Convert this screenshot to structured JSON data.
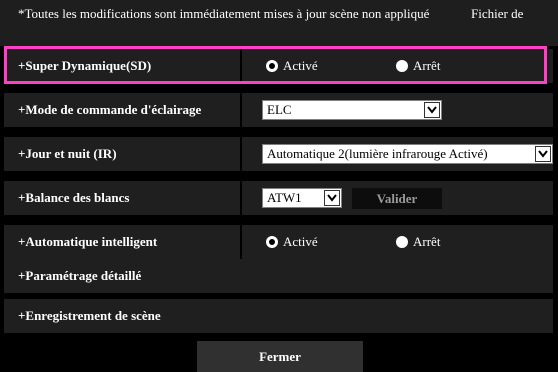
{
  "notice": {
    "message": "*Toutes les modifications sont immédiatement mises à jour scène non appliqué",
    "file_label": "Fichier de"
  },
  "rows": {
    "super_dynamic": {
      "label": "+Super Dynamique(SD)",
      "option_on": "Activé",
      "option_off": "Arrêt",
      "selected": "Activé"
    },
    "light_control": {
      "label": "+Mode de commande d'éclairage",
      "value": "ELC"
    },
    "day_night": {
      "label": "+Jour et nuit (IR)",
      "value": "Automatique 2(lumière infrarouge Activé)"
    },
    "white_balance": {
      "label": "+Balance des blancs",
      "value": "ATW1",
      "apply_label": "Valider"
    },
    "intelligent_auto": {
      "label": "+Automatique intelligent",
      "option_on": "Activé",
      "option_off": "Arrêt",
      "selected": "Activé"
    },
    "detailed": {
      "label": "+Paramétrage détaillé"
    },
    "scene_save": {
      "label": "+Enregistrement de scène"
    }
  },
  "close_label": "Fermer",
  "colors": {
    "highlight": "#ff3fc6",
    "row_bg": "#1f1f1f",
    "button_bg": "#303030"
  }
}
